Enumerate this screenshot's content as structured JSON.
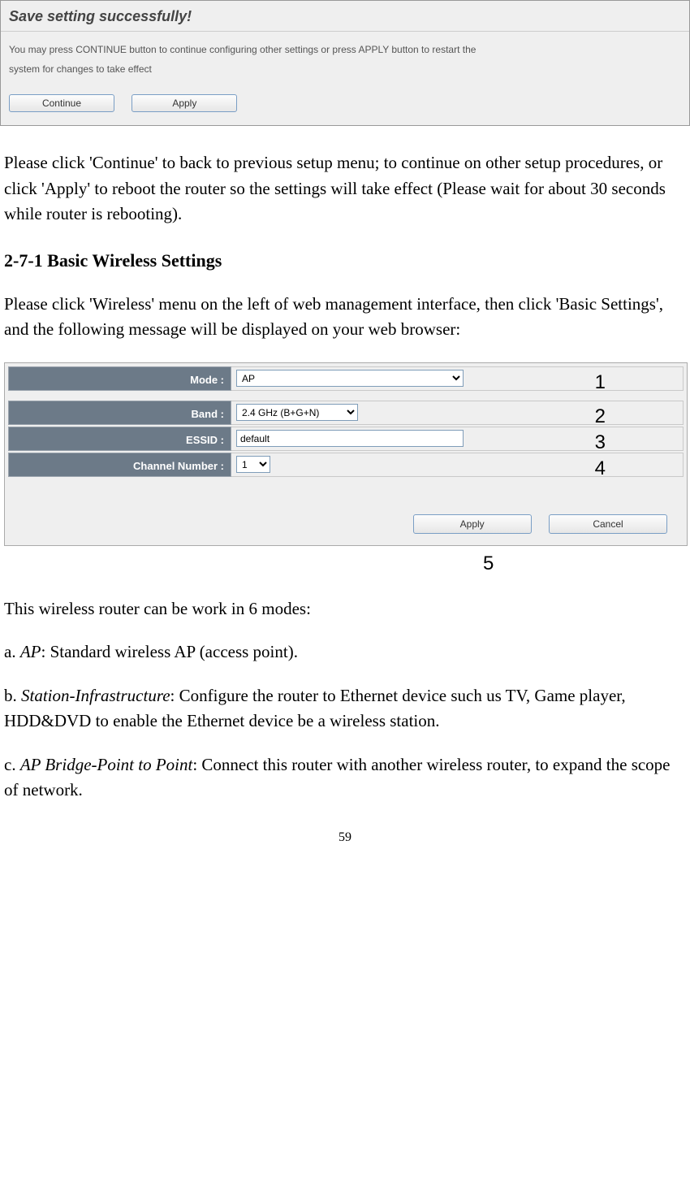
{
  "dialog": {
    "title": "Save setting successfully!",
    "message1": "You may press CONTINUE button to continue configuring other settings or press APPLY button to restart the",
    "message2": "system for changes to take effect",
    "continue": "Continue",
    "apply": "Apply"
  },
  "para1": "Please click 'Continue' to back to previous setup menu; to continue on other setup procedures, or click 'Apply' to reboot the router so the settings will take effect (Please wait for about 30 seconds while router is rebooting).",
  "section_title": "2-7-1 Basic Wireless Settings",
  "para2": "Please click 'Wireless' menu on the left of web management interface, then click 'Basic Settings', and the following message will be displayed on your web browser:",
  "settings": {
    "rows": {
      "mode": {
        "label": "Mode :",
        "value": "AP",
        "callout": "1"
      },
      "band": {
        "label": "Band :",
        "value": "2.4 GHz (B+G+N)",
        "callout": "2"
      },
      "essid": {
        "label": "ESSID :",
        "value": "default",
        "callout": "3"
      },
      "channel": {
        "label": "Channel Number :",
        "value": "1",
        "callout": "4"
      }
    },
    "apply": "Apply",
    "cancel": "Cancel",
    "callout5": "5"
  },
  "modes_intro": "This wireless router can be work in 6 modes:",
  "mode_a": {
    "prefix": "a. ",
    "name": "AP",
    "rest": ": Standard wireless AP (access point)."
  },
  "mode_b": {
    "prefix": "b. ",
    "name": "Station-Infrastructure",
    "rest": ": Configure the router to Ethernet device such us TV, Game player, HDD&DVD to enable the Ethernet device be a wireless station."
  },
  "mode_c": {
    "prefix": "c. ",
    "name": "AP Bridge-Point to Point",
    "rest": ": Connect this router with another wireless router, to expand the scope of network."
  },
  "page_number": "59"
}
